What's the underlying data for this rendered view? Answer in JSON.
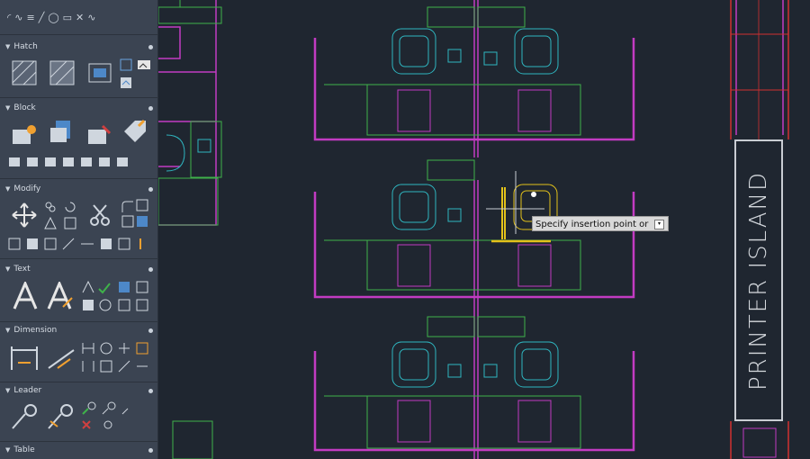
{
  "palette": {
    "sections": [
      {
        "label": "Hatch"
      },
      {
        "label": "Block"
      },
      {
        "label": "Modify"
      },
      {
        "label": "Text"
      },
      {
        "label": "Dimension"
      },
      {
        "label": "Leader"
      },
      {
        "label": "Table"
      }
    ]
  },
  "drawing": {
    "tooltip": "Specify insertion point or",
    "printer_label": "PRINTER ISLAND"
  },
  "colors": {
    "palette_bg": "#3b4452",
    "canvas_bg": "#1f2630",
    "wall": "#c23bc2",
    "desk": "#3fb24a",
    "chair": "#2fb6c0",
    "cursor_block": "#e3c21a"
  }
}
